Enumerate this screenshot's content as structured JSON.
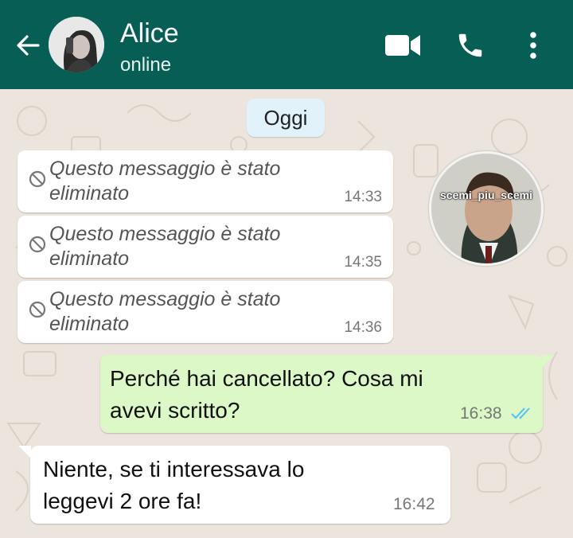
{
  "header": {
    "contact_name": "Alice",
    "status": "online",
    "icons": {
      "back": "arrow-left-icon",
      "video": "video-camera-icon",
      "call": "phone-icon",
      "menu": "more-vertical-icon"
    }
  },
  "date_label": "Oggi",
  "messages": [
    {
      "type": "deleted",
      "direction": "in",
      "text": "Questo messaggio è stato eliminato",
      "time": "14:33"
    },
    {
      "type": "deleted",
      "direction": "in",
      "text": "Questo messaggio è stato eliminato",
      "time": "14:35"
    },
    {
      "type": "deleted",
      "direction": "in",
      "text": "Questo messaggio è stato eliminato",
      "time": "14:36"
    },
    {
      "type": "text",
      "direction": "out",
      "text": "Perché hai cancellato? Cosa mi avevi scritto?",
      "time": "16:38",
      "read": true
    },
    {
      "type": "text",
      "direction": "in",
      "text": "Niente, se ti interessava lo leggevi 2 ore fa!",
      "time": "16:42"
    }
  ],
  "watermark": {
    "text": "scemi_piu_scemi"
  },
  "colors": {
    "header": "#075e54",
    "chat_background": "#ece5dd",
    "incoming_bubble": "#ffffff",
    "outgoing_bubble": "#dcf8c6",
    "read_ticks": "#4fc3f7",
    "date_chip": "#e1f2fa"
  }
}
